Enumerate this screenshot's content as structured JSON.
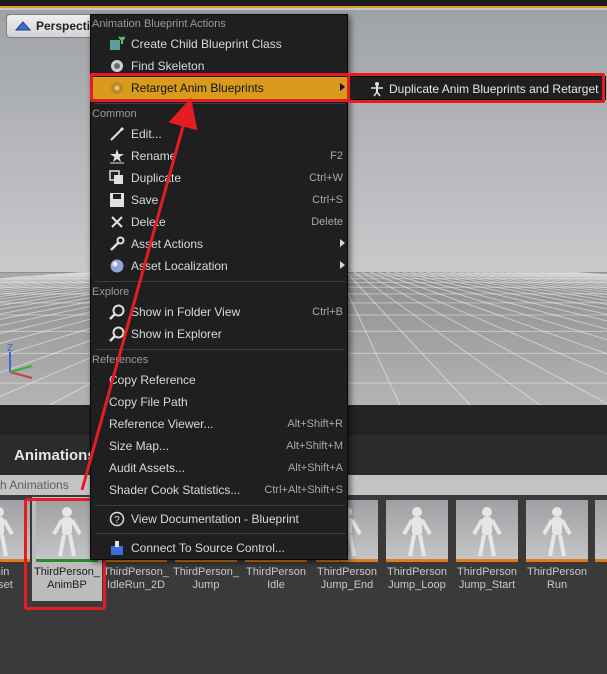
{
  "viewport": {
    "perspective_label": "Perspective",
    "axis_label": "Z"
  },
  "context_menu": {
    "section_actions": "Animation Blueprint Actions",
    "create_child": "Create Child Blueprint Class",
    "find_skeleton": "Find Skeleton",
    "retarget": "Retarget Anim Blueprints",
    "section_common": "Common",
    "edit": "Edit...",
    "rename": "Rename",
    "rename_shortcut": "F2",
    "duplicate": "Duplicate",
    "duplicate_shortcut": "Ctrl+W",
    "save": "Save",
    "save_shortcut": "Ctrl+S",
    "delete": "Delete",
    "delete_shortcut": "Delete",
    "asset_actions": "Asset Actions",
    "asset_localization": "Asset Localization",
    "section_explore": "Explore",
    "show_folder": "Show in Folder View",
    "show_folder_shortcut": "Ctrl+B",
    "show_explorer": "Show in Explorer",
    "section_references": "References",
    "copy_reference": "Copy Reference",
    "copy_file_path": "Copy File Path",
    "reference_viewer": "Reference Viewer...",
    "reference_viewer_shortcut": "Alt+Shift+R",
    "size_map": "Size Map...",
    "size_map_shortcut": "Alt+Shift+M",
    "audit_assets": "Audit Assets...",
    "audit_assets_shortcut": "Alt+Shift+A",
    "shader_cook": "Shader Cook Statistics...",
    "shader_cook_shortcut": "Ctrl+Alt+Shift+S",
    "view_docs": "View Documentation - Blueprint",
    "connect_source": "Connect To Source Control..."
  },
  "submenu": {
    "duplicate_retarget": "Duplicate Anim Blueprints and Retarget"
  },
  "content_browser": {
    "title": "Animations",
    "filter_label": "h Animations",
    "assets": [
      {
        "line1": "quin",
        "line2": "Asset"
      },
      {
        "line1": "ThirdPerson_",
        "line2": "AnimBP"
      },
      {
        "line1": "ThirdPerson_",
        "line2": "IdleRun_2D"
      },
      {
        "line1": "ThirdPerson_",
        "line2": "Jump"
      },
      {
        "line1": "ThirdPerson",
        "line2": "Idle"
      },
      {
        "line1": "ThirdPerson",
        "line2": "Jump_End"
      },
      {
        "line1": "ThirdPerson",
        "line2": "Jump_Loop"
      },
      {
        "line1": "ThirdPerson",
        "line2": "Jump_Start"
      },
      {
        "line1": "ThirdPerson",
        "line2": "Run"
      },
      {
        "line1": "Th",
        "line2": ""
      }
    ]
  },
  "colors": {
    "highlight": "#d99b1c",
    "annotation_red": "#e51c23",
    "menu_bg": "#1f1f1f"
  }
}
